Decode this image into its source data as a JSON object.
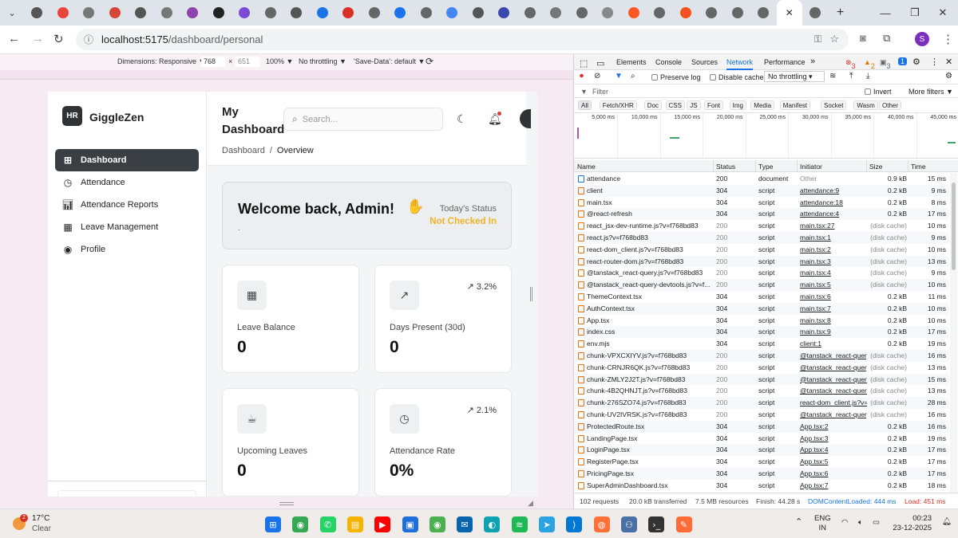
{
  "browser": {
    "tab_count": 31,
    "new_tab": "+",
    "url_host": "localhost:5175",
    "url_path": "/dashboard/personal",
    "profile_initial": "S",
    "window_controls": [
      "—",
      "❐",
      "✕"
    ]
  },
  "device_toolbar": {
    "dimensions_label": "Dimensions: Responsive ▼",
    "width": "768",
    "times": "×",
    "height": "651",
    "zoom": "100% ▼",
    "throttle": "No throttling ▼",
    "save_data": "'Save-Data': default ▼"
  },
  "app": {
    "logo_initials": "HR",
    "brand": "GiggleZen",
    "nav": [
      {
        "label": "Dashboard",
        "icon": "grid-icon"
      },
      {
        "label": "Attendance",
        "icon": "clock-icon"
      },
      {
        "label": "Attendance Reports",
        "icon": "bar-chart-icon"
      },
      {
        "label": "Leave Management",
        "icon": "calendar-icon"
      },
      {
        "label": "Profile",
        "icon": "user-circle-icon"
      }
    ],
    "page_title": "My Dashboard",
    "search_placeholder": "Search...",
    "breadcrumb": {
      "root": "Dashboard",
      "sep": "/",
      "current": "Overview"
    },
    "welcome": {
      "title": "Welcome back, Admin!",
      "subtitle": ".",
      "status_label": "Today's Status",
      "status_value": "Not Checked In",
      "status_color": "#f0b429"
    },
    "cards": [
      {
        "label": "Leave Balance",
        "value": "0",
        "icon": "calendar-icon",
        "trend": ""
      },
      {
        "label": "Days Present (30d)",
        "value": "0",
        "icon": "trending-up-icon",
        "trend": "↗ 3.2%"
      },
      {
        "label": "Upcoming Leaves",
        "value": "0",
        "icon": "coffee-icon",
        "trend": ""
      },
      {
        "label": "Attendance Rate",
        "value": "0%",
        "icon": "clock-icon",
        "trend": "↗ 2.1%"
      }
    ]
  },
  "devtools": {
    "tabs": [
      "Elements",
      "Console",
      "Sources",
      "Network",
      "Performance"
    ],
    "active_tab": "Network",
    "more": "»",
    "errors": "3",
    "warnings": "2",
    "info": "3",
    "issues": "1",
    "preserve_log": "Preserve log",
    "disable_cache": "Disable cache",
    "throttling": "No throttling",
    "filter_placeholder": "Filter",
    "invert": "Invert",
    "more_filters": "More filters ▼",
    "type_filters": [
      "All",
      "Fetch/XHR",
      "Doc",
      "CSS",
      "JS",
      "Font",
      "Img",
      "Media",
      "Manifest",
      "Socket",
      "Wasm",
      "Other"
    ],
    "timeline_ticks": [
      "5,000 ms",
      "10,000 ms",
      "15,000 ms",
      "20,000 ms",
      "25,000 ms",
      "30,000 ms",
      "35,000 ms",
      "40,000 ms",
      "45,000 ms"
    ],
    "columns": [
      "Name",
      "Status",
      "Type",
      "Initiator",
      "Size",
      "Time"
    ],
    "requests": [
      {
        "name": "attendance",
        "status": "200",
        "type": "document",
        "initiator": "Other",
        "size": "0.9 kB",
        "time": "15 ms"
      },
      {
        "name": "client",
        "status": "304",
        "type": "script",
        "initiator": "attendance:9",
        "size": "0.2 kB",
        "time": "9 ms"
      },
      {
        "name": "main.tsx",
        "status": "304",
        "type": "script",
        "initiator": "attendance:18",
        "size": "0.2 kB",
        "time": "8 ms"
      },
      {
        "name": "@react-refresh",
        "status": "304",
        "type": "script",
        "initiator": "attendance:4",
        "size": "0.2 kB",
        "time": "17 ms"
      },
      {
        "name": "react_jsx-dev-runtime.js?v=f768bd83",
        "status": "200",
        "type": "script",
        "initiator": "main.tsx:27",
        "size": "(disk cache)",
        "time": "10 ms"
      },
      {
        "name": "react.js?v=f768bd83",
        "status": "200",
        "type": "script",
        "initiator": "main.tsx:1",
        "size": "(disk cache)",
        "time": "9 ms"
      },
      {
        "name": "react-dom_client.js?v=f768bd83",
        "status": "200",
        "type": "script",
        "initiator": "main.tsx:2",
        "size": "(disk cache)",
        "time": "10 ms"
      },
      {
        "name": "react-router-dom.js?v=f768bd83",
        "status": "200",
        "type": "script",
        "initiator": "main.tsx:3",
        "size": "(disk cache)",
        "time": "13 ms"
      },
      {
        "name": "@tanstack_react-query.js?v=f768bd83",
        "status": "200",
        "type": "script",
        "initiator": "main.tsx:4",
        "size": "(disk cache)",
        "time": "9 ms"
      },
      {
        "name": "@tanstack_react-query-devtools.js?v=f...",
        "status": "200",
        "type": "script",
        "initiator": "main.tsx:5",
        "size": "(disk cache)",
        "time": "10 ms"
      },
      {
        "name": "ThemeContext.tsx",
        "status": "304",
        "type": "script",
        "initiator": "main.tsx:6",
        "size": "0.2 kB",
        "time": "11 ms"
      },
      {
        "name": "AuthContext.tsx",
        "status": "304",
        "type": "script",
        "initiator": "main.tsx:7",
        "size": "0.2 kB",
        "time": "10 ms"
      },
      {
        "name": "App.tsx",
        "status": "304",
        "type": "script",
        "initiator": "main.tsx:8",
        "size": "0.2 kB",
        "time": "10 ms"
      },
      {
        "name": "index.css",
        "status": "304",
        "type": "script",
        "initiator": "main.tsx:9",
        "size": "0.2 kB",
        "time": "17 ms"
      },
      {
        "name": "env.mjs",
        "status": "304",
        "type": "script",
        "initiator": "client:1",
        "size": "0.2 kB",
        "time": "19 ms"
      },
      {
        "name": "chunk-VPXCXIYV.js?v=f768bd83",
        "status": "200",
        "type": "script",
        "initiator": "@tanstack_react-query",
        "size": "(disk cache)",
        "time": "16 ms"
      },
      {
        "name": "chunk-CRNJR6QK.js?v=f768bd83",
        "status": "200",
        "type": "script",
        "initiator": "@tanstack_react-query",
        "size": "(disk cache)",
        "time": "13 ms"
      },
      {
        "name": "chunk-ZMLY2J2T.js?v=f768bd83",
        "status": "200",
        "type": "script",
        "initiator": "@tanstack_react-query",
        "size": "(disk cache)",
        "time": "15 ms"
      },
      {
        "name": "chunk-4B2QHNJT.js?v=f768bd83",
        "status": "200",
        "type": "script",
        "initiator": "@tanstack_react-query",
        "size": "(disk cache)",
        "time": "13 ms"
      },
      {
        "name": "chunk-276SZO74.js?v=f768bd83",
        "status": "200",
        "type": "script",
        "initiator": "react-dom_client.js?v=",
        "size": "(disk cache)",
        "time": "28 ms"
      },
      {
        "name": "chunk-UV2IVRSK.js?v=f768bd83",
        "status": "200",
        "type": "script",
        "initiator": "@tanstack_react-query",
        "size": "(disk cache)",
        "time": "16 ms"
      },
      {
        "name": "ProtectedRoute.tsx",
        "status": "304",
        "type": "script",
        "initiator": "App.tsx:2",
        "size": "0.2 kB",
        "time": "16 ms"
      },
      {
        "name": "LandingPage.tsx",
        "status": "304",
        "type": "script",
        "initiator": "App.tsx:3",
        "size": "0.2 kB",
        "time": "19 ms"
      },
      {
        "name": "LoginPage.tsx",
        "status": "304",
        "type": "script",
        "initiator": "App.tsx:4",
        "size": "0.2 kB",
        "time": "17 ms"
      },
      {
        "name": "RegisterPage.tsx",
        "status": "304",
        "type": "script",
        "initiator": "App.tsx:5",
        "size": "0.2 kB",
        "time": "17 ms"
      },
      {
        "name": "PricingPage.tsx",
        "status": "304",
        "type": "script",
        "initiator": "App.tsx:6",
        "size": "0.2 kB",
        "time": "17 ms"
      },
      {
        "name": "SuperAdminDashboard.tsx",
        "status": "304",
        "type": "script",
        "initiator": "App.tsx:7",
        "size": "0.2 kB",
        "time": "18 ms"
      }
    ],
    "footer": {
      "requests": "102 requests",
      "transferred": "20.0 kB transferred",
      "resources": "7.5 MB resources",
      "finish": "Finish: 44.28 s",
      "dcl": "DOMContentLoaded: 444 ms",
      "load": "Load: 451 ms",
      "dcl_color": "#1a73e8",
      "load_color": "#d93025"
    }
  },
  "taskbar": {
    "weather_badge": "2",
    "temperature": "17°C",
    "condition": "Clear",
    "lang_line1": "ENG",
    "lang_line2": "IN",
    "time": "00:23",
    "date": "23-12-2025"
  }
}
